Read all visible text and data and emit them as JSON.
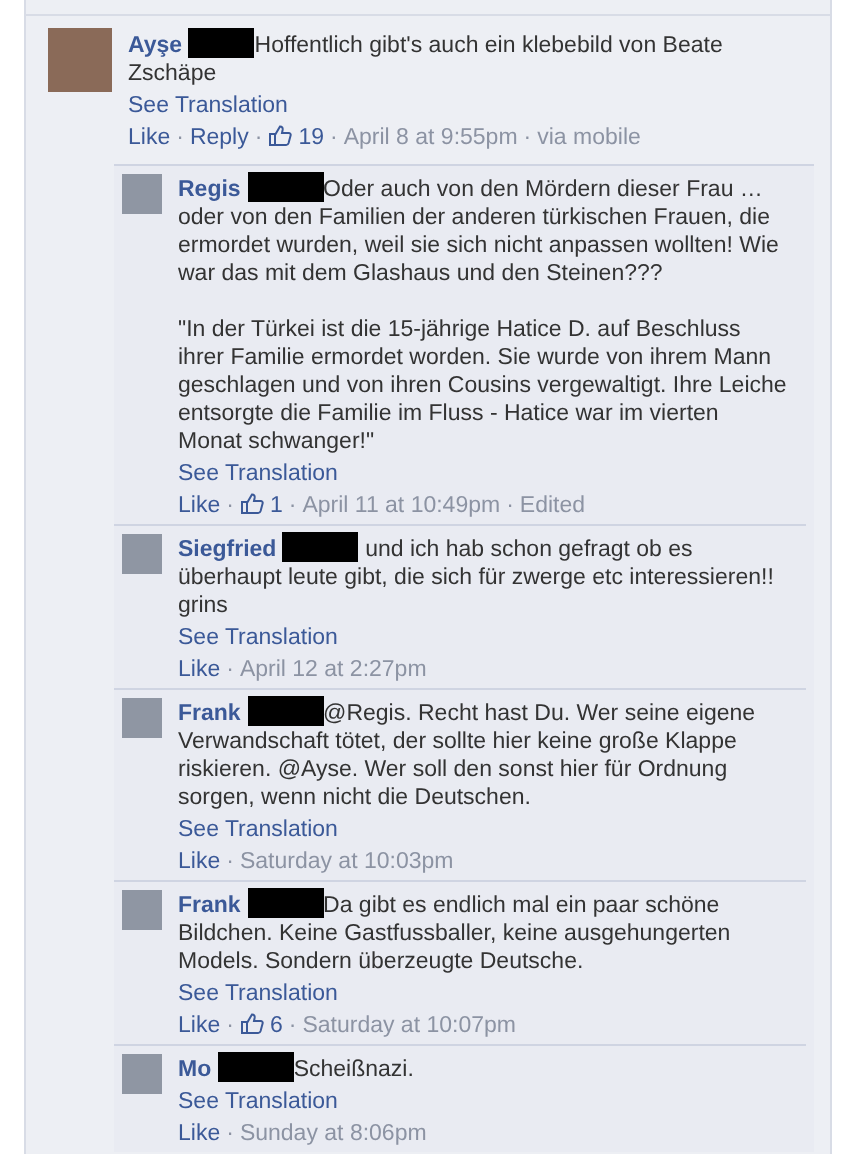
{
  "separator": "·",
  "comment": {
    "author": "Ayşe",
    "text": [
      "Hoffentlich gibt's auch ein klebebild von Beate Zschäpe"
    ],
    "translation_link": "See Translation",
    "actions": [
      "Like",
      "Reply"
    ],
    "likes": "19",
    "time": "April 8 at 9:55pm",
    "note": "via mobile",
    "replies": [
      {
        "author": "Regis",
        "text": [
          "Oder auch von den Mördern dieser Frau … oder von den Familien der anderen türkischen Frauen, die ermordet wurden, weil sie sich nicht anpassen wollten! Wie war das mit dem Glashaus und den Steinen???",
          "\"In der Türkei ist die 15-jährige Hatice D. auf Beschluss ihrer Familie ermordet worden. Sie wurde von ihrem Mann geschlagen und von ihren Cousins vergewaltigt. Ihre Leiche entsorgte die Familie im Fluss - Hatice war im vierten Monat schwanger!\""
        ],
        "translation_link": "See Translation",
        "actions": [
          "Like"
        ],
        "likes": "1",
        "time": "April 11 at 10:49pm",
        "note": "Edited"
      },
      {
        "author": "Siegfried",
        "text": [
          " und ich hab schon gefragt ob es überhaupt leute gibt, die sich für zwerge etc interessieren!! grins"
        ],
        "translation_link": "See Translation",
        "actions": [
          "Like"
        ],
        "time": "April 12 at 2:27pm"
      },
      {
        "author": "Frank",
        "text": [
          "@Regis. Recht hast Du. Wer seine eigene Verwandschaft tötet, der sollte hier keine große Klappe riskieren. @Ayse. Wer soll den sonst hier für Ordnung sorgen, wenn nicht die Deutschen."
        ],
        "translation_link": "See Translation",
        "actions": [
          "Like"
        ],
        "time": "Saturday at 10:03pm"
      },
      {
        "author": "Frank",
        "text": [
          "Da gibt es endlich mal ein paar schöne Bildchen. Keine Gastfussballer, keine ausgehungerten Models. Sondern überzeugte Deutsche."
        ],
        "translation_link": "See Translation",
        "actions": [
          "Like"
        ],
        "likes": "6",
        "time": "Saturday at 10:07pm"
      },
      {
        "author": "Mo",
        "text": [
          "Scheißnazi."
        ],
        "translation_link": "See Translation",
        "actions": [
          "Like"
        ],
        "time": "Sunday at 8:06pm"
      }
    ]
  }
}
